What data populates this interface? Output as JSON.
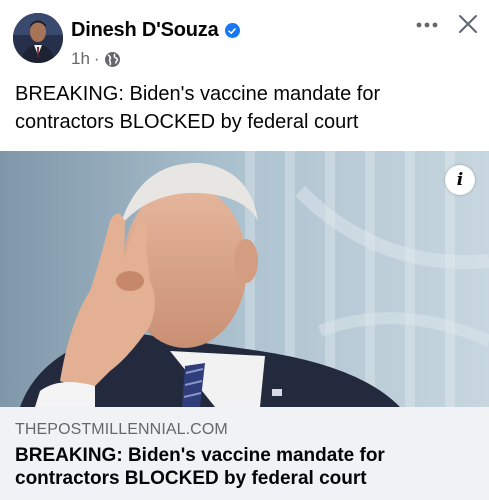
{
  "post": {
    "author": "Dinesh D'Souza",
    "time": "1h",
    "separator": "·",
    "text": "BREAKING: Biden's vaccine mandate for contractors BLOCKED by federal court"
  },
  "header": {
    "more_icon": "more-horizontal-icon",
    "close_icon": "close-icon",
    "verified_icon": "verified-badge-icon",
    "privacy_icon": "globe-icon"
  },
  "link_preview": {
    "domain": "THEPOSTMILLENNIAL.COM",
    "title": "BREAKING: Biden's vaccine mandate for contractors BLOCKED by federal court",
    "info_label": "i"
  },
  "colors": {
    "accent": "#1877f2",
    "secondary_text": "#65676b",
    "card_footer_bg": "#f0f2f5"
  }
}
